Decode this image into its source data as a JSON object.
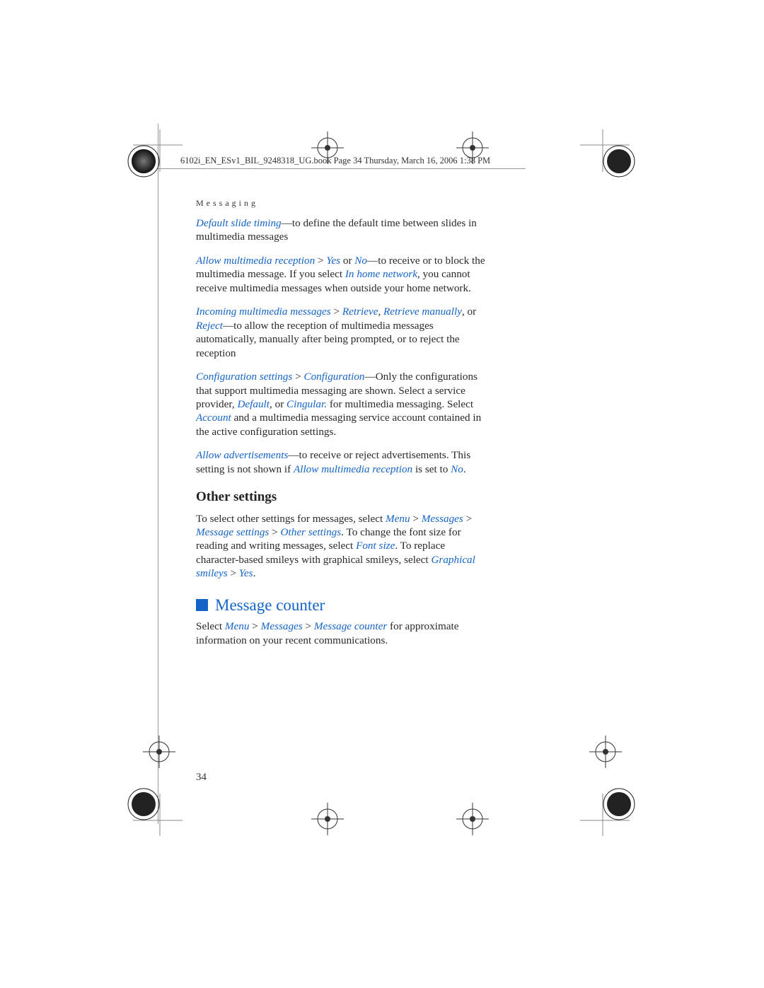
{
  "header": "6102i_EN_ESv1_BIL_9248318_UG.book  Page 34  Thursday, March 16, 2006  1:38 PM",
  "section": "Messaging",
  "p1": {
    "em1": "Default slide timing",
    "t1": "—to define the default time between slides in multimedia messages"
  },
  "p2": {
    "em1": "Allow multimedia reception",
    "t1": " > ",
    "em2": "Yes",
    "t2": " or ",
    "em3": "No",
    "t3": "—to receive or to block the multimedia message. If you select ",
    "em4": "In home network",
    "t4": ", you cannot receive multimedia messages when outside your home network."
  },
  "p3": {
    "em1": "Incoming multimedia messages",
    "t1": " > ",
    "em2": "Retrieve",
    "t2": ", ",
    "em3": "Retrieve manually",
    "t3": ", or ",
    "em4": "Reject",
    "t4": "—to allow the reception of multimedia messages automatically, manually after being prompted, or to reject the reception"
  },
  "p4": {
    "em1": "Configuration settings",
    "t1": " > ",
    "em2": "Configuration",
    "t2": "—Only the configurations that support multimedia messaging are shown. Select a service provider, ",
    "em3": "Default",
    "t3": ", or ",
    "em4": "Cingular.",
    "t4": " for multimedia messaging. Select ",
    "em5": "Account",
    "t5": " and a multimedia messaging service account contained in the active configuration settings."
  },
  "p5": {
    "em1": "Allow advertisements",
    "t1": "—to receive or reject advertisements. This setting is not shown if ",
    "em2": "Allow multimedia reception",
    "t2": " is set to ",
    "em3": "No",
    "t3": "."
  },
  "h3": "Other settings",
  "p6": {
    "t1": "To select other settings for messages, select ",
    "em1": "Menu",
    "t2": " > ",
    "em2": "Messages",
    "t3": " > ",
    "em3": "Message settings",
    "t4": " > ",
    "em4": "Other settings",
    "t5": ". To change the font size for reading and writing messages, select ",
    "em5": "Font size",
    "t6": ". To replace character-based smileys with graphical smileys, select ",
    "em6": "Graphical smileys",
    "t7": " > ",
    "em7": "Yes",
    "t8": "."
  },
  "h2": "Message counter",
  "p7": {
    "t1": "Select ",
    "em1": "Menu",
    "t2": " > ",
    "em2": "Messages",
    "t3": " > ",
    "em3": "Message counter",
    "t4": " for approximate information on your recent communications."
  },
  "pageNum": "34"
}
